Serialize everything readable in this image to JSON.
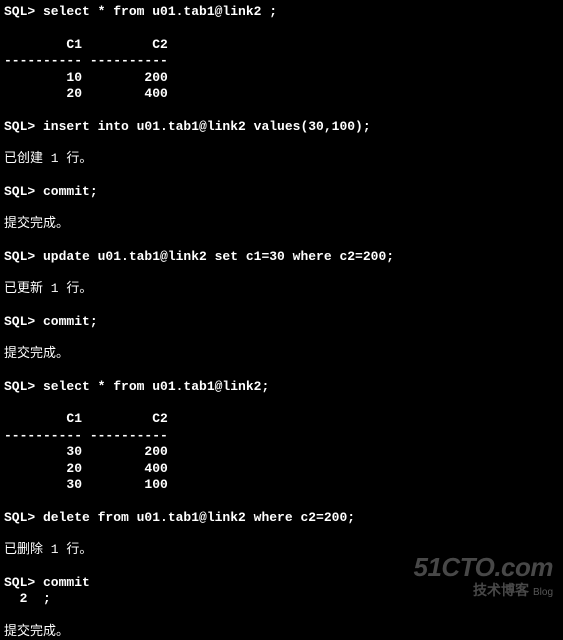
{
  "prompt": "SQL>",
  "lines": [
    {
      "type": "cmd",
      "text": "SQL> select * from u01.tab1@link2 ;"
    },
    {
      "type": "blank"
    },
    {
      "type": "cmd",
      "text": "        C1         C2"
    },
    {
      "type": "cmd",
      "text": "---------- ----------"
    },
    {
      "type": "cmd",
      "text": "        10        200"
    },
    {
      "type": "cmd",
      "text": "        20        400"
    },
    {
      "type": "blank"
    },
    {
      "type": "cmd",
      "text": "SQL> insert into u01.tab1@link2 values(30,100);"
    },
    {
      "type": "blank"
    },
    {
      "type": "msg",
      "text": "已创建 1 行。"
    },
    {
      "type": "blank"
    },
    {
      "type": "cmd",
      "text": "SQL> commit;"
    },
    {
      "type": "blank"
    },
    {
      "type": "msg",
      "text": "提交完成。"
    },
    {
      "type": "blank"
    },
    {
      "type": "cmd",
      "text": "SQL> update u01.tab1@link2 set c1=30 where c2=200;"
    },
    {
      "type": "blank"
    },
    {
      "type": "msg",
      "text": "已更新 1 行。"
    },
    {
      "type": "blank"
    },
    {
      "type": "cmd",
      "text": "SQL> commit;"
    },
    {
      "type": "blank"
    },
    {
      "type": "msg",
      "text": "提交完成。"
    },
    {
      "type": "blank"
    },
    {
      "type": "cmd",
      "text": "SQL> select * from u01.tab1@link2;"
    },
    {
      "type": "blank"
    },
    {
      "type": "cmd",
      "text": "        C1         C2"
    },
    {
      "type": "cmd",
      "text": "---------- ----------"
    },
    {
      "type": "cmd",
      "text": "        30        200"
    },
    {
      "type": "cmd",
      "text": "        20        400"
    },
    {
      "type": "cmd",
      "text": "        30        100"
    },
    {
      "type": "blank"
    },
    {
      "type": "cmd",
      "text": "SQL> delete from u01.tab1@link2 where c2=200;"
    },
    {
      "type": "blank"
    },
    {
      "type": "msg",
      "text": "已删除 1 行。"
    },
    {
      "type": "blank"
    },
    {
      "type": "cmd",
      "text": "SQL> commit"
    },
    {
      "type": "cmd",
      "text": "  2  ;"
    },
    {
      "type": "blank"
    },
    {
      "type": "msg",
      "text": "提交完成。"
    }
  ],
  "watermark": {
    "main": "51CTO.com",
    "sub": "技术博客",
    "blog": "Blog"
  }
}
